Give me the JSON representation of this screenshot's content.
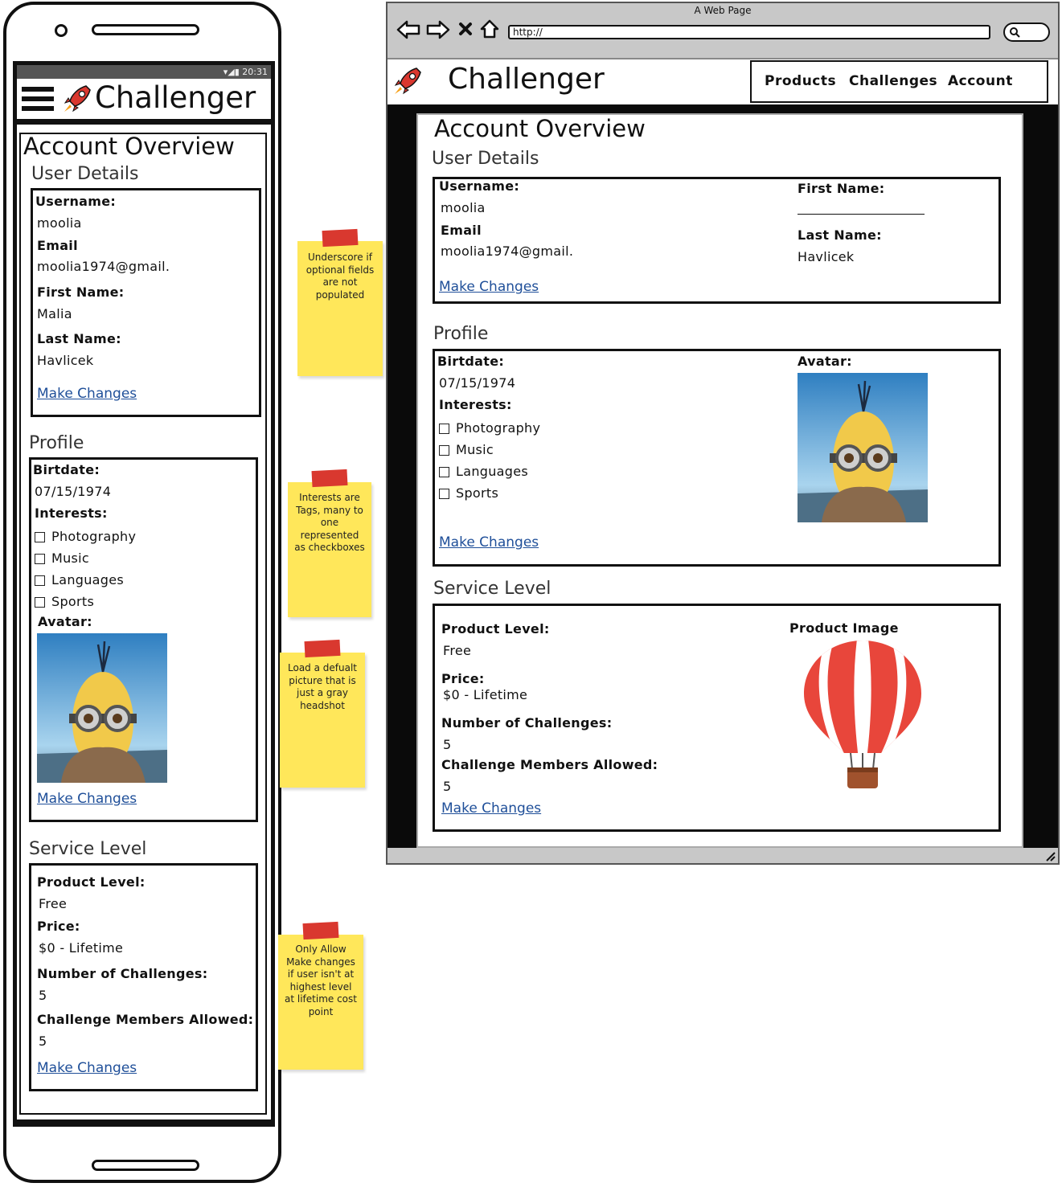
{
  "mobile": {
    "status_time": "20:31",
    "app_title": "Challenger",
    "page_title": "Account Overview",
    "user_details": {
      "heading": "User Details",
      "username_label": "Username:",
      "username": "moolia",
      "email_label": "Email",
      "email": "moolia1974@gmail.",
      "first_name_label": "First Name:",
      "first_name": "Malia",
      "last_name_label": "Last Name:",
      "last_name": "Havlicek",
      "make_changes": "Make Changes"
    },
    "profile": {
      "heading": "Profile",
      "birthdate_label": "Birtdate:",
      "birthdate": "07/15/1974",
      "interests_label": "Interests:",
      "interests": [
        "Photography",
        "Music",
        "Languages",
        "Sports"
      ],
      "avatar_label": "Avatar:",
      "make_changes": "Make Changes"
    },
    "service": {
      "heading": "Service Level",
      "product_level_label": "Product Level:",
      "product_level": "Free",
      "price_label": "Price:",
      "price": "$0 - Lifetime",
      "challenges_label": "Number of Challenges:",
      "challenges": "5",
      "members_label": "Challenge Members Allowed:",
      "members": "5",
      "make_changes": "Make Changes"
    }
  },
  "notes": [
    "Underscore if optional fields are not populated",
    "Interests are Tags, many to one represented as checkboxes",
    "Load a defualt picture that is just a gray headshot",
    "Only Allow Make changes if user isn't at highest level at lifetime cost point"
  ],
  "browser": {
    "window_title": "A Web Page",
    "url": "http://",
    "app_title": "Challenger",
    "nav": [
      "Products",
      "Challenges",
      "Account"
    ],
    "page_title": "Account Overview",
    "user_details": {
      "heading": "User Details",
      "username_label": "Username:",
      "username": "moolia",
      "email_label": "Email",
      "email": "moolia1974@gmail.",
      "first_name_label": "First Name:",
      "last_name_label": "Last Name:",
      "last_name": "Havlicek",
      "make_changes": "Make Changes"
    },
    "profile": {
      "heading": "Profile",
      "birthdate_label": "Birtdate:",
      "birthdate": "07/15/1974",
      "interests_label": "Interests:",
      "interests": [
        "Photography",
        "Music",
        "Languages",
        "Sports"
      ],
      "avatar_label": "Avatar:",
      "make_changes": "Make Changes"
    },
    "service": {
      "heading": "Service Level",
      "product_level_label": "Product Level:",
      "product_level": "Free",
      "price_label": "Price:",
      "price": "$0 - Lifetime",
      "challenges_label": "Number of Challenges:",
      "challenges": "5",
      "members_label": "Challenge Members Allowed:",
      "members": "5",
      "product_image_label": "Product Image",
      "make_changes": "Make Changes"
    }
  },
  "colors": {
    "link": "#1f4f99",
    "sticky": "#ffe75a",
    "tape": "#d9382f",
    "balloon_red": "#e8463b",
    "dark_bg": "#0a0a0a",
    "browser_chrome": "#c8c8c8"
  }
}
